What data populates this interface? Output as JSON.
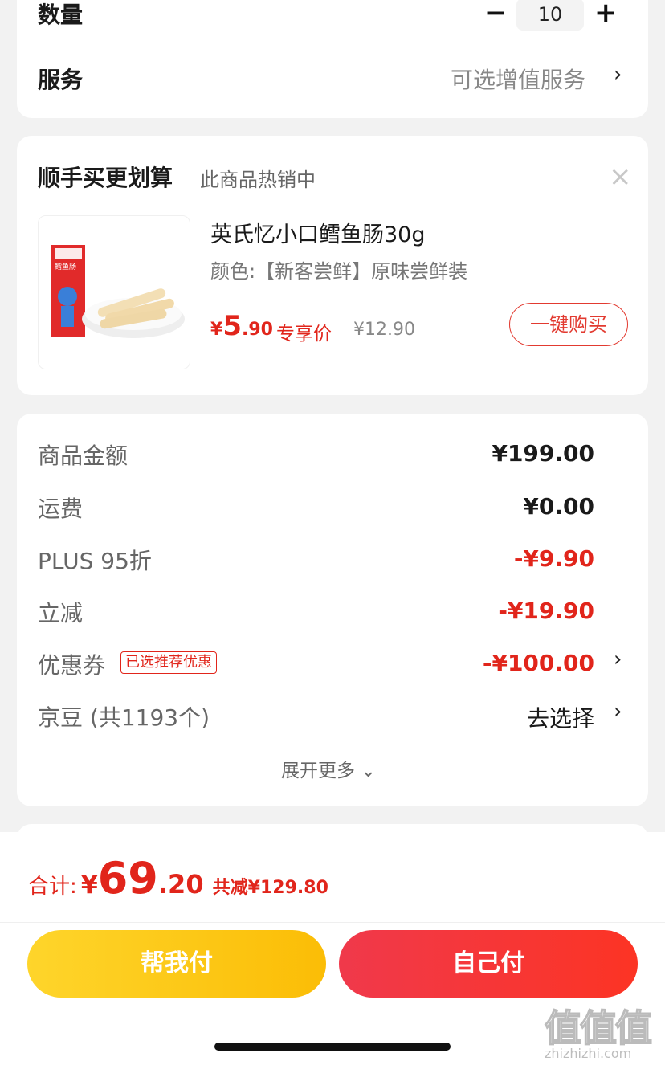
{
  "quantity": {
    "label": "数量",
    "value": "10",
    "minus": "−",
    "plus": "+"
  },
  "service": {
    "label": "服务",
    "value": "可选增值服务",
    "chevron": "›"
  },
  "upsell": {
    "title": "顺手买更划算",
    "subtitle": "此商品热销中",
    "close_icon": "×",
    "product": {
      "name": "英氏忆小口鳕鱼肠30g",
      "spec": "颜色:【新客尝鲜】原味尝鲜装",
      "price_symbol": "¥",
      "price_int": "5",
      "price_dec": ".90",
      "price_tag": "专享价",
      "original_price": "¥12.90",
      "buy_button": "一键购买",
      "box_label": "鳕鱼肠"
    }
  },
  "pricing": {
    "rows": [
      {
        "label": "商品金额",
        "value": "¥199.00"
      },
      {
        "label": "运费",
        "value": "¥0.00"
      },
      {
        "label": "PLUS 95折",
        "value": "-¥9.90"
      },
      {
        "label": "立减",
        "value": "-¥19.90"
      },
      {
        "label": "优惠券",
        "tag": "已选推荐优惠",
        "value": "-¥100.00",
        "chevron": "›"
      },
      {
        "label": "京豆 (共1193个)",
        "value": "去选择",
        "chevron": "›"
      }
    ],
    "expand": "展开更多",
    "expand_icon": "⌄"
  },
  "total": {
    "label": "合计:",
    "symbol": "¥",
    "int": "69",
    "dec": ".20",
    "savings": "共减¥129.80"
  },
  "buttons": {
    "help_pay": "帮我付",
    "self_pay": "自己付"
  },
  "watermark": {
    "text": "值值值",
    "url": "zhizhizhi.com"
  },
  "colors": {
    "accent_red": "#e1251b",
    "yellow": "#fbbd06",
    "background": "#f2f2f2"
  }
}
